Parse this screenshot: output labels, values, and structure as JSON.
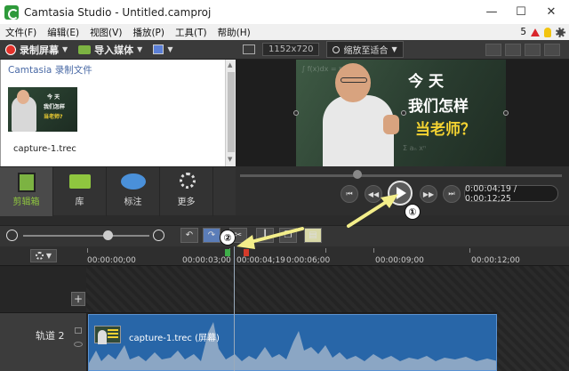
{
  "window": {
    "title": "Camtasia Studio - Untitled.camproj",
    "minimize": "—",
    "maximize": "☐",
    "close": "✕"
  },
  "menu": {
    "items": [
      "文件(F)",
      "编辑(E)",
      "视图(V)",
      "播放(P)",
      "工具(T)",
      "帮助(H)"
    ],
    "notification_count": "5"
  },
  "left_toolbar": {
    "record_label": "录制屏幕",
    "import_label": "导入媒体"
  },
  "clip_bin": {
    "title": "Camtasia 录制文件",
    "items": [
      {
        "name": "capture-1.trec"
      }
    ]
  },
  "left_tabs": [
    {
      "label": "剪辑箱",
      "active": true
    },
    {
      "label": "库",
      "active": false
    },
    {
      "label": "标注",
      "active": false
    },
    {
      "label": "更多",
      "active": false
    }
  ],
  "preview_toolbar": {
    "dimensions": "1152x720",
    "zoom_label": "缩放至适合"
  },
  "preview": {
    "caption_line1": "今天",
    "caption_line2": "我们怎样",
    "caption_line3": "当老师？"
  },
  "playback": {
    "time_display": "0:00:04;19 / 0:00:12;25"
  },
  "ruler": {
    "labels": [
      "00:00:00;00",
      "00:00:03;00",
      "00:00:04;19",
      "0:00:06;00",
      "00:00:09;00",
      "00:00:12;00"
    ]
  },
  "tracks": [
    {
      "name": "轨道 2",
      "clip_name": "capture-1.trec (屏幕)"
    }
  ],
  "annotations": {
    "step1": "①",
    "step2": "②"
  },
  "colors": {
    "accent_green": "#8fc63f",
    "record_red": "#e4322b",
    "clip_blue": "#2866a8",
    "arrow_yellow": "#f3ee8a"
  }
}
